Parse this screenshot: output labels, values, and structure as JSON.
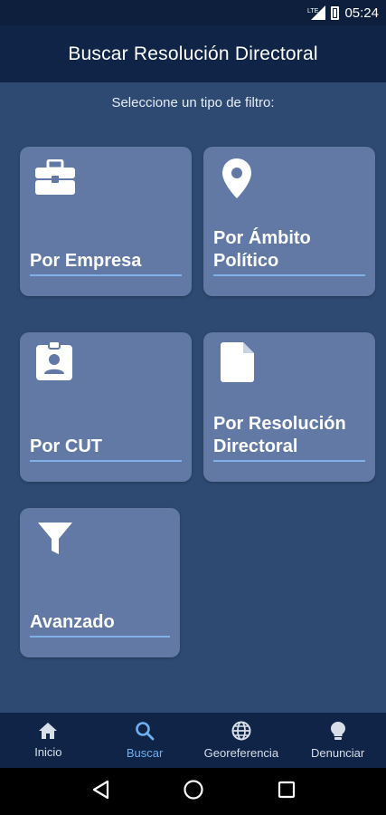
{
  "status_bar": {
    "network": "LTE",
    "time": "05:24"
  },
  "app_bar": {
    "title": "Buscar Resolución Directoral"
  },
  "subtitle": "Seleccione un tipo de filtro:",
  "filters": [
    {
      "label": "Por Empresa",
      "icon": "briefcase-icon"
    },
    {
      "label": "Por Ámbito Político",
      "icon": "map-marker-icon"
    },
    {
      "label": "Por CUT",
      "icon": "id-badge-icon"
    },
    {
      "label": "Por Resolución Directoral",
      "icon": "document-icon"
    },
    {
      "label": "Avanzado",
      "icon": "filter-icon"
    }
  ],
  "bottom_nav": {
    "items": [
      {
        "label": "Inicio",
        "icon": "home-icon"
      },
      {
        "label": "Buscar",
        "icon": "search-icon",
        "active": true
      },
      {
        "label": "Georeferencia",
        "icon": "globe-icon"
      },
      {
        "label": "Denunciar",
        "icon": "lightbulb-icon"
      }
    ]
  },
  "colors": {
    "background": "#2e4a72",
    "app_bar": "#0f2447",
    "card": "#6279a6",
    "underline": "#7fb1e8",
    "active_nav": "#6fb0f0"
  }
}
